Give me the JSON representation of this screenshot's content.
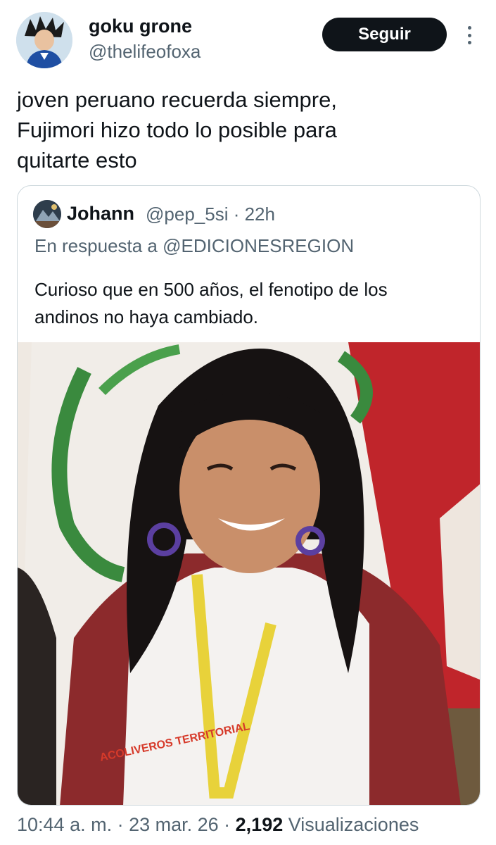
{
  "author": {
    "display_name": "goku grone",
    "handle": "@thelifeofoxa",
    "avatar_icon": "goku-avatar"
  },
  "follow_button": {
    "label": "Seguir"
  },
  "more_icon": "more-vertical-icon",
  "tweet": {
    "lines": [
      "joven peruano recuerda siempre,",
      "Fujimori hizo todo lo posible para",
      "quitarte esto"
    ]
  },
  "quoted": {
    "display_name": "Johann",
    "meta": "@pep_5si · 22h",
    "reply_to": "En respuesta a @EDICIONESREGION",
    "lines": [
      "Curioso que en 500 años, el fenotipo de los",
      "andinos no haya cambiado."
    ],
    "media_text": "ACOLIVEROS TERRITORIAL"
  },
  "footer": {
    "time_date": "10:44 a. m. · 23 mar. 26 · ",
    "views_count": "2,192",
    "views_label": " Visualizaciones"
  },
  "colors": {
    "text_primary": "#0f1419",
    "text_secondary": "#536471",
    "border": "#cfd9de",
    "button_bg": "#0f1419"
  }
}
